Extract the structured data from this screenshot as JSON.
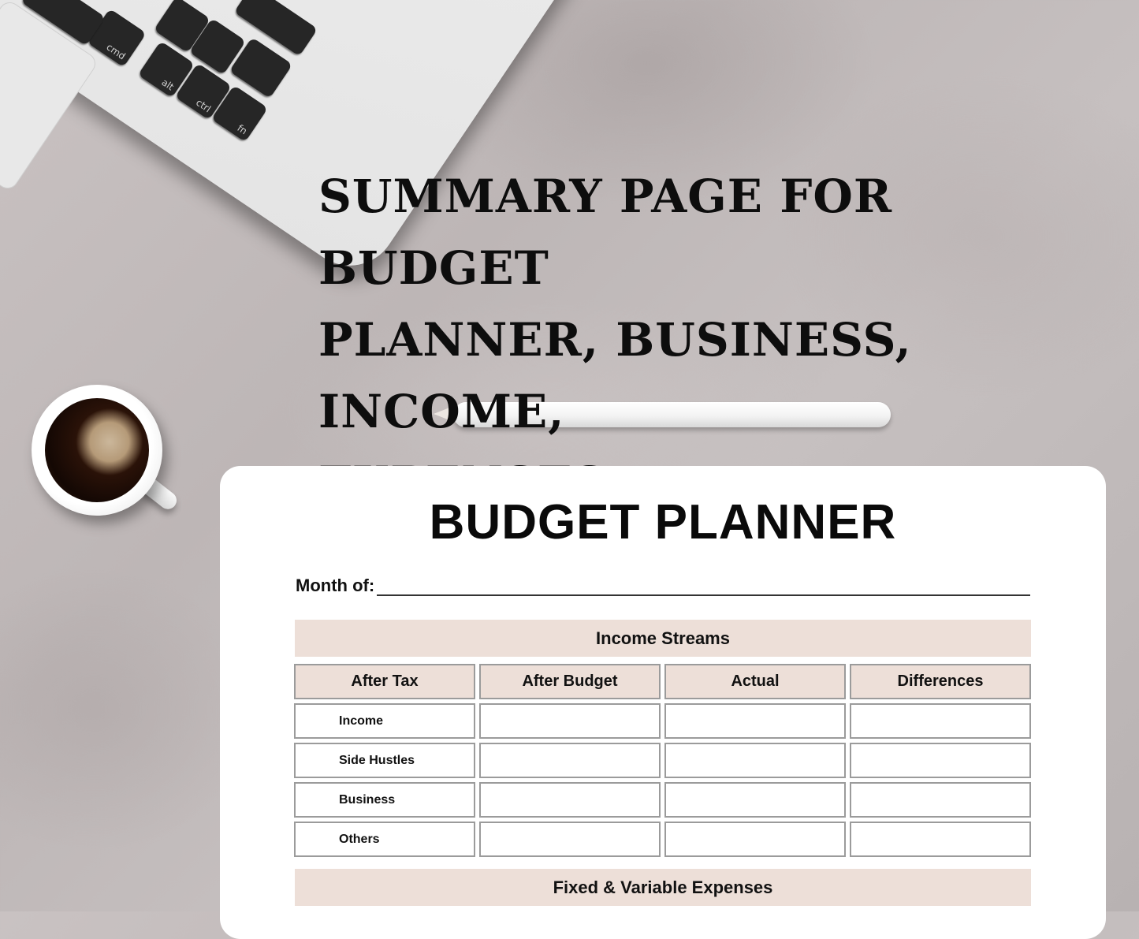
{
  "headline": {
    "lines": [
      "SUMMARY PAGE FOR BUDGET",
      "PLANNER, BUSINESS, INCOME,",
      "EXPENSES"
    ]
  },
  "decor": {
    "laptop_keys": [
      "cmd",
      "alt",
      "ctrl",
      "fn"
    ],
    "icons": [
      "laptop-icon",
      "coffee-cup-icon",
      "stylus-pencil-icon"
    ]
  },
  "planner": {
    "title": "BUDGET PLANNER",
    "month_label": "Month of:",
    "month_value": "",
    "income_section": {
      "title": "Income Streams",
      "columns": [
        "After Tax",
        "After Budget",
        "Actual",
        "Differences"
      ],
      "rows": [
        {
          "label": "Income",
          "after_budget": "",
          "actual": "",
          "differences": ""
        },
        {
          "label": "Side Hustles",
          "after_budget": "",
          "actual": "",
          "differences": ""
        },
        {
          "label": "Business",
          "after_budget": "",
          "actual": "",
          "differences": ""
        },
        {
          "label": "Others",
          "after_budget": "",
          "actual": "",
          "differences": ""
        }
      ]
    },
    "expenses_section": {
      "title": "Fixed & Variable Expenses"
    }
  },
  "colors": {
    "band": "#eddfd8",
    "border": "#9b9b9b",
    "text": "#111111"
  }
}
